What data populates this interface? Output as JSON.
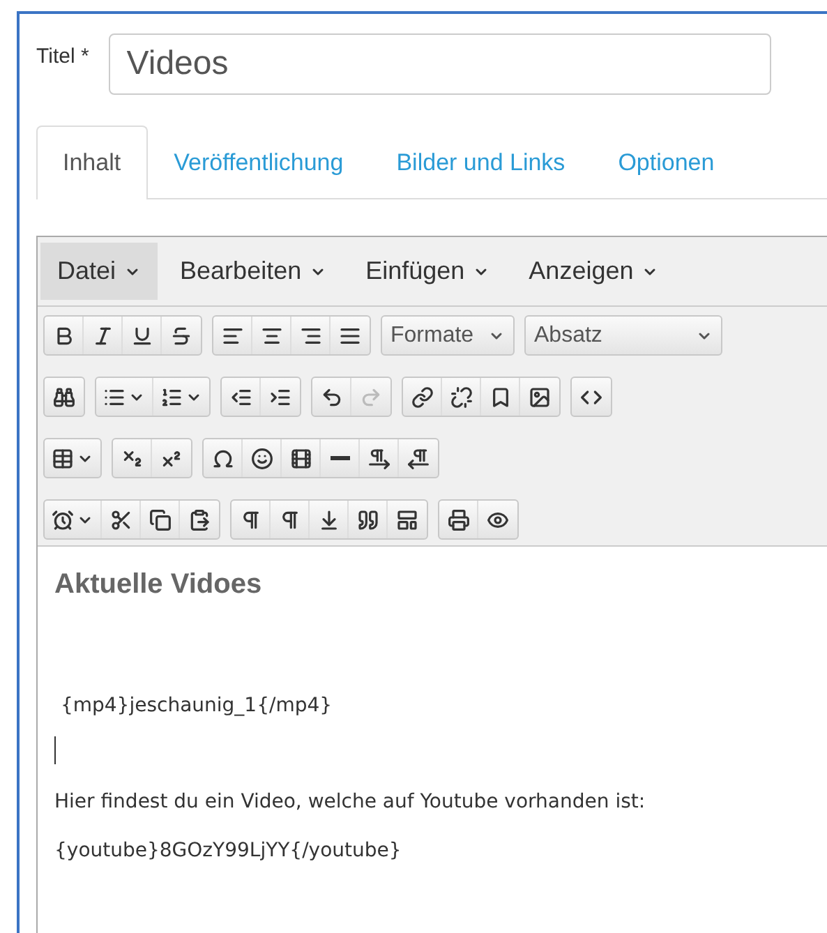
{
  "title_field": {
    "label": "Titel *",
    "value": "Videos"
  },
  "tabs": [
    {
      "label": "Inhalt",
      "selected": true
    },
    {
      "label": "Veröffentlichung",
      "selected": false
    },
    {
      "label": "Bilder und Links",
      "selected": false
    },
    {
      "label": "Optionen",
      "selected": false
    }
  ],
  "menubar": [
    {
      "label": "Datei",
      "selected": true
    },
    {
      "label": "Bearbeiten",
      "selected": false
    },
    {
      "label": "Einfügen",
      "selected": false
    },
    {
      "label": "Anzeigen",
      "selected": false
    }
  ],
  "toolbar": {
    "formats_dropdown": "Formate",
    "block_dropdown": "Absatz",
    "redo_disabled": true
  },
  "content": [
    {
      "kind": "heading",
      "text": "Aktuelle Vidoes"
    },
    {
      "kind": "blank"
    },
    {
      "kind": "paragraph",
      "text": " {mp4}jeschaunig_1{/mp4}"
    },
    {
      "kind": "cursor"
    },
    {
      "kind": "paragraph",
      "text": "Hier findest du ein Video, welche auf Youtube vorhanden ist:"
    },
    {
      "kind": "paragraph",
      "text": "{youtube}8GOzY99LjYY{/youtube}"
    }
  ]
}
